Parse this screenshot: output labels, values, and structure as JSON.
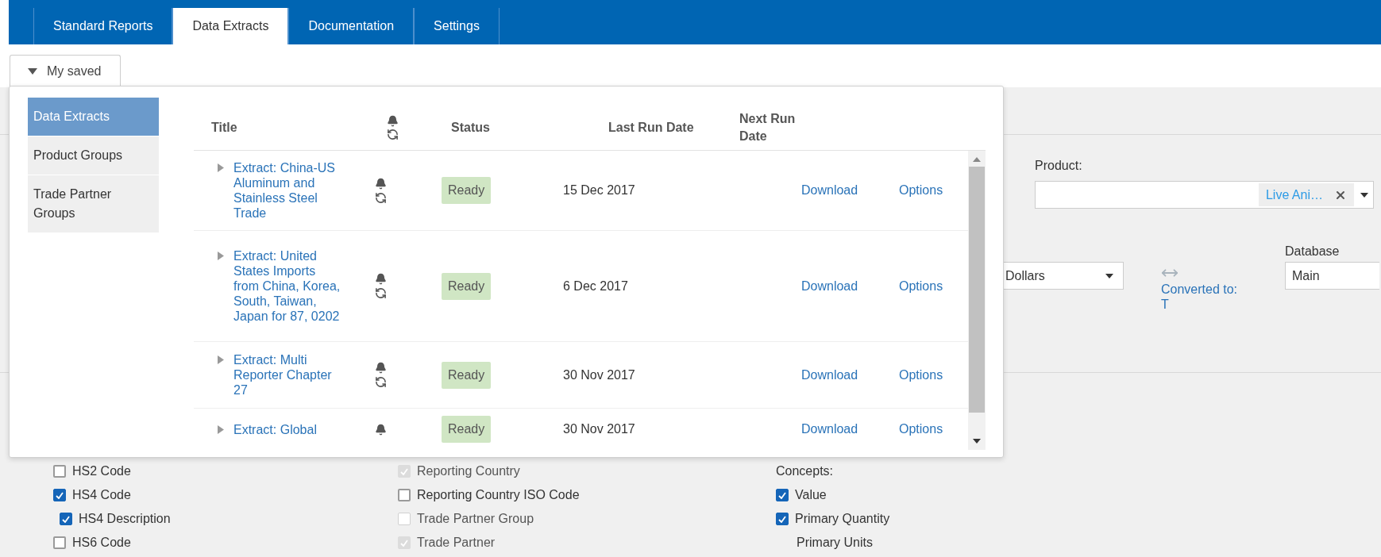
{
  "tabs": [
    {
      "label": "Standard Reports",
      "selected": false
    },
    {
      "label": "Data Extracts",
      "selected": true
    },
    {
      "label": "Documentation",
      "selected": false
    },
    {
      "label": "Settings",
      "selected": false
    }
  ],
  "saved_panel": {
    "toggle": "My saved",
    "expanded": true,
    "sidebar": [
      {
        "label": "Data Extracts",
        "selected": true
      },
      {
        "label": "Product Groups",
        "selected": false
      },
      {
        "label": "Trade Partner Groups",
        "selected": false
      }
    ],
    "table": {
      "columns": [
        "Title",
        "Status",
        "Last Run Date",
        "Next Run Date"
      ],
      "rows": [
        {
          "title": "Extract: China-US Aluminum and Stainless Steel Trade",
          "status": "Ready",
          "last_run": "15 Dec 2017",
          "download": "Download",
          "options": "Options"
        },
        {
          "title": "Extract: United States Imports from China, Korea, South, Taiwan, Japan for 87, 0202",
          "status": "Ready",
          "last_run": "6 Dec 2017",
          "download": "Download",
          "options": "Options"
        },
        {
          "title": "Extract: Multi Reporter Chapter 27",
          "status": "Ready",
          "last_run": "30 Nov 2017",
          "download": "Download",
          "options": "Options"
        },
        {
          "title": "Extract: Global",
          "status": "Ready",
          "last_run": "30 Nov 2017",
          "download": "Download",
          "options": "Options"
        }
      ]
    }
  },
  "filters": {
    "product_label": "Product:",
    "product_chip": "Live Ani…",
    "unit_select": "Dollars",
    "converted": "Converted to: T",
    "database_label": "Database",
    "database_value": "Main"
  },
  "field_columns": [
    {
      "items": [
        {
          "kind": "checkbox",
          "label": "HS2 Code",
          "checked": false,
          "disabled": false
        },
        {
          "kind": "checkbox",
          "label": "HS4 Code",
          "checked": true,
          "disabled": false,
          "children": [
            {
              "kind": "checkbox",
              "label": "HS4 Description",
              "checked": true,
              "disabled": false
            }
          ]
        },
        {
          "kind": "checkbox",
          "label": "HS6 Code",
          "checked": false,
          "disabled": false
        }
      ]
    },
    {
      "items": [
        {
          "kind": "checkbox",
          "label": "Reporting Country",
          "checked": true,
          "disabled": true
        },
        {
          "kind": "checkbox",
          "label": "Reporting Country ISO Code",
          "checked": false,
          "disabled": false
        },
        {
          "kind": "checkbox",
          "label": "Trade Partner Group",
          "checked": false,
          "disabled": true
        },
        {
          "kind": "checkbox",
          "label": "Trade Partner",
          "checked": true,
          "disabled": true
        }
      ]
    },
    {
      "heading": "Concepts:",
      "items": [
        {
          "kind": "checkbox",
          "label": "Value",
          "checked": true,
          "disabled": false
        },
        {
          "kind": "checkbox",
          "label": "Primary Quantity",
          "checked": true,
          "disabled": false,
          "children": [
            {
              "kind": "text",
              "label": "Primary Units"
            }
          ]
        }
      ]
    }
  ]
}
